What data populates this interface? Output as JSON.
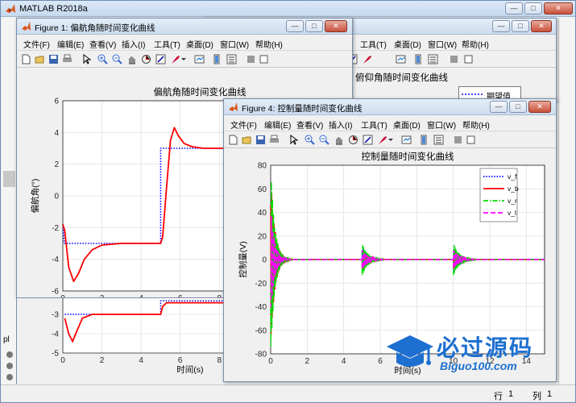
{
  "app": {
    "title": "MATLAB R2018a"
  },
  "status": {
    "row_label": "行",
    "row_value": "1",
    "col_label": "列",
    "col_value": "1"
  },
  "sidebar": {
    "fragment": "pl"
  },
  "menu": [
    "文件(F)",
    "编辑(E)",
    "查看(V)",
    "插入(I)",
    "工具(T)",
    "桌面(D)",
    "窗口(W)",
    "帮助(H)"
  ],
  "figures": {
    "fig1": {
      "title": "Figure 1: 偏航角随时间变化曲线",
      "chart_data": {
        "type": "line",
        "title": "偏航角随时间变化曲线",
        "xlabel": "时间(s)",
        "ylabel": "偏航角(°)",
        "xlim": [
          0,
          14
        ],
        "ylim": [
          -6,
          6
        ],
        "xticks": [
          0,
          2,
          4,
          6,
          8,
          10,
          12
        ],
        "yticks": [
          -6,
          -4,
          -2,
          0,
          2,
          4,
          6
        ],
        "grid": true,
        "legend_position": "top-right",
        "series": [
          {
            "name": "期望值",
            "color": "#0000ff",
            "style": "dotted",
            "x": [
              0,
              0.08,
              5.0,
              5.0,
              10.0,
              10.0,
              14
            ],
            "y": [
              -1.8,
              -3,
              -3,
              3,
              3,
              -3,
              -3
            ]
          },
          {
            "color": "#ff0000",
            "style": "solid",
            "x": [
              0,
              0.1,
              0.3,
              0.55,
              0.8,
              1.1,
              1.5,
              2.0,
              3.0,
              4.0,
              5.0,
              5.1,
              5.3,
              5.5,
              5.7,
              5.9,
              6.2,
              6.6,
              7.2,
              8.0,
              9.0,
              10.0,
              10.1,
              10.3,
              10.5,
              10.7,
              10.9,
              11.2,
              11.6,
              12.2,
              13.0,
              14
            ],
            "y": [
              -1.8,
              -2.2,
              -4.5,
              -5.4,
              -4.9,
              -4.0,
              -3.4,
              -3.1,
              -3.0,
              -3.0,
              -3.0,
              -2.6,
              0.5,
              3.5,
              4.3,
              3.8,
              3.3,
              3.1,
              3.0,
              3.0,
              3.0,
              3.0,
              2.6,
              -0.5,
              -3.5,
              -4.4,
              -3.9,
              -3.3,
              -3.1,
              -3.0,
              -3.0,
              -3.0
            ]
          }
        ]
      },
      "lower_chart": {
        "type": "line",
        "xlabel": "时间(s)",
        "ylim": [
          -5,
          -3
        ],
        "yticks": [
          -3,
          -4,
          -5
        ],
        "xticks": [
          0,
          2,
          4,
          6,
          8,
          10,
          12
        ]
      }
    },
    "fig2": {
      "title_fragment": "俯仰角随时间变化曲线",
      "legend_label": "期望值"
    },
    "fig4": {
      "title": "Figure 4: 控制量随时间变化曲线",
      "chart_data": {
        "type": "line",
        "title": "控制量随时间变化曲线",
        "xlabel": "时间(s)",
        "ylabel": "控制量(V)",
        "xlim": [
          0,
          15
        ],
        "ylim": [
          -80,
          80
        ],
        "xticks": [
          0,
          2,
          4,
          6,
          8,
          10,
          12,
          14
        ],
        "yticks": [
          -80,
          -60,
          -40,
          -20,
          0,
          20,
          40,
          60,
          80
        ],
        "grid": true,
        "legend_position": "top-right",
        "series": [
          {
            "name": "v_f",
            "color": "#0000ff",
            "style": "dotted",
            "amp0": 40,
            "ampS": 12
          },
          {
            "name": "v_b",
            "color": "#ff0000",
            "style": "solid",
            "amp0": 75,
            "ampS": 10
          },
          {
            "name": "v_r",
            "color": "#00dd00",
            "style": "dashdot",
            "amp0": 80,
            "ampS": 14
          },
          {
            "name": "v_l",
            "color": "#ff00ff",
            "style": "dashed",
            "amp0": 45,
            "ampS": 9
          }
        ],
        "event_times": [
          0,
          5,
          10,
          15
        ]
      }
    }
  },
  "watermark": {
    "brand": "必过源码",
    "url": "Biguo100.com"
  }
}
